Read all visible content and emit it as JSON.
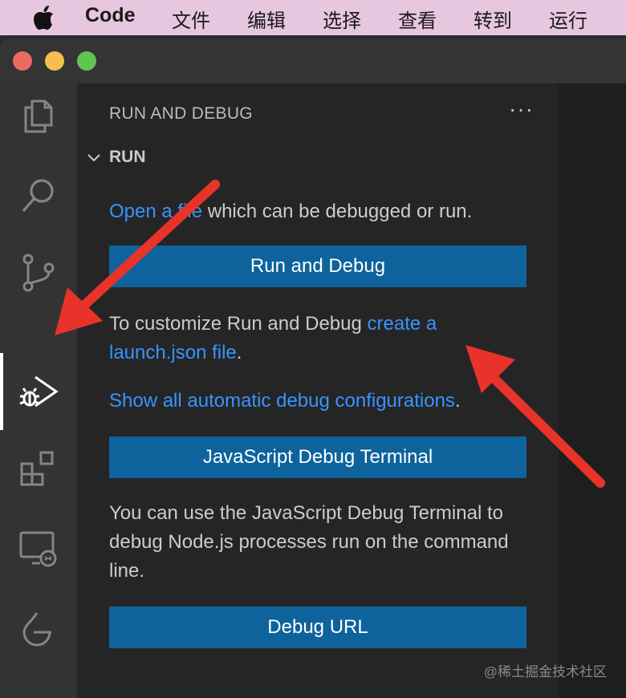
{
  "menubar": {
    "app_name": "Code",
    "items": [
      "文件",
      "编辑",
      "选择",
      "查看",
      "转到",
      "运行"
    ]
  },
  "activity_bar": {
    "icons": [
      "files-icon",
      "search-icon",
      "source-control-icon",
      "run-debug-icon",
      "extensions-icon",
      "remote-explorer-icon",
      "testing-icon"
    ],
    "active": "run-debug-icon"
  },
  "sidebar": {
    "title": "RUN AND DEBUG",
    "more": "···",
    "section": "RUN",
    "open_file_link": "Open a file",
    "open_file_rest": " which can be debugged or run.",
    "run_button": "Run and Debug",
    "customize_prefix": "To customize Run and Debug ",
    "customize_link": "create a launch.json file",
    "customize_suffix": ".",
    "show_all_link": "Show all automatic debug configurations",
    "show_all_suffix": ".",
    "js_terminal_button": "JavaScript Debug Terminal",
    "js_terminal_desc": "You can use the JavaScript Debug Terminal to debug Node.js processes run on the command line.",
    "debug_url_button": "Debug URL"
  },
  "watermark": "@稀土掘金技术社区",
  "colors": {
    "link": "#3794ff",
    "button": "#0e639c",
    "arrow": "#e8332a",
    "menubar": "#e6c7df"
  }
}
